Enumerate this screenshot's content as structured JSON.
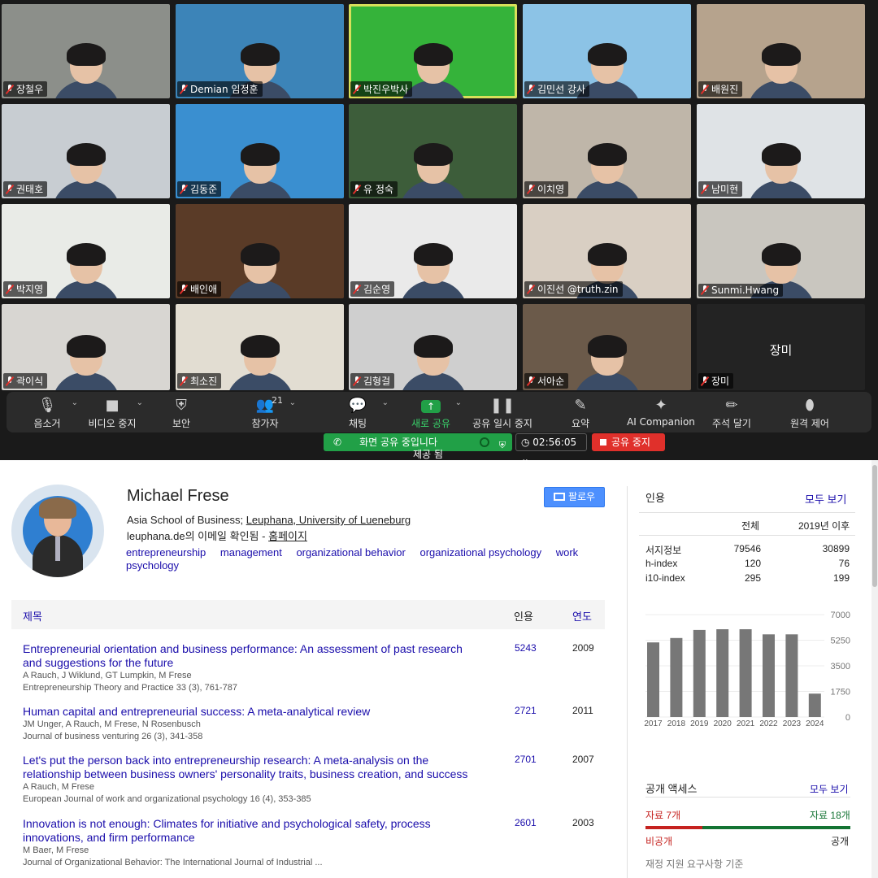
{
  "meeting": {
    "participants": [
      {
        "name": "장철우",
        "bg": "#8c8f8a"
      },
      {
        "name": "Demian 임정훈",
        "bg": "#3c84b8"
      },
      {
        "name": "박진우박사",
        "bg": "#35b33a"
      },
      {
        "name": "김민선 강사",
        "bg": "#8cc3e6"
      },
      {
        "name": "배원진",
        "bg": "#b6a38d"
      },
      {
        "name": "권태호",
        "bg": "#c8cdd2"
      },
      {
        "name": "김동준",
        "bg": "#3a8fd0"
      },
      {
        "name": "유 정숙",
        "bg": "#3d5d3a"
      },
      {
        "name": "이치영",
        "bg": "#bfb6a9"
      },
      {
        "name": "남미현",
        "bg": "#dfe3e6"
      },
      {
        "name": "박지영",
        "bg": "#e9ebe7"
      },
      {
        "name": "배인애",
        "bg": "#5a3b27"
      },
      {
        "name": "김순영",
        "bg": "#eaeaea"
      },
      {
        "name": "이진선 @truth.zin",
        "bg": "#d9cfc3"
      },
      {
        "name": "Sunmi.Hwang",
        "bg": "#c9c6bf"
      },
      {
        "name": "곽이식",
        "bg": "#d8d6d2"
      },
      {
        "name": "최소진",
        "bg": "#e2ddd2"
      },
      {
        "name": "김형걸",
        "bg": "#cfcfcf"
      },
      {
        "name": "서아순",
        "bg": "#6b5a4a"
      },
      {
        "name": "장미",
        "bg": "#232323",
        "name_only": true
      }
    ],
    "controls": [
      {
        "label": "음소거",
        "icon": "🎙"
      },
      {
        "label": "비디오 중지",
        "icon": "■"
      },
      {
        "label": "보안",
        "icon": "⛨"
      },
      {
        "label": "참가자",
        "icon": "👥",
        "count": "21"
      },
      {
        "label": "채팅",
        "icon": "💬"
      },
      {
        "label": "새로 공유",
        "icon": "↑"
      },
      {
        "label": "공유 일시 중지",
        "icon": "❚❚"
      },
      {
        "label": "요약",
        "icon": "✎"
      },
      {
        "label": "AI Companion",
        "icon": "✦"
      },
      {
        "label": "주석 달기",
        "icon": "✏"
      },
      {
        "label": "원격 제어",
        "icon": "⬮"
      }
    ],
    "banner_text": "화면 공유 중입니다",
    "timer": "02:56:05",
    "stop_label": "공유 중지",
    "overlap_text": "제공 됨"
  },
  "scholar": {
    "name": "Michael Frese",
    "affiliation_prefix": "Asia School of Business; ",
    "affiliation_link": "Leuphana, University of Lueneburg",
    "email_prefix": "leuphana.de의 이메일 확인됨 - ",
    "homepage_link": "홈페이지",
    "interests": [
      "entrepreneurship",
      "management",
      "organizational behavior",
      "organizational psychology",
      "work psychology"
    ],
    "follow_label": "팔로우",
    "table_header": {
      "title": "제목",
      "cites": "인용",
      "year": "연도"
    },
    "publications": [
      {
        "title": "Entrepreneurial orientation and business performance: An assessment of past research and suggestions for the future",
        "authors": "A Rauch, J Wiklund, GT Lumpkin, M Frese",
        "venue": "Entrepreneurship Theory and Practice 33 (3), 761-787",
        "cites": "5243",
        "year": "2009"
      },
      {
        "title": "Human capital and entrepreneurial success: A meta-analytical review",
        "authors": "JM Unger, A Rauch, M Frese, N Rosenbusch",
        "venue": "Journal of business venturing 26 (3), 341-358",
        "cites": "2721",
        "year": "2011"
      },
      {
        "title": "Let's put the person back into entrepreneurship research: A meta-analysis on the relationship between business owners' personality traits, business creation, and success",
        "authors": "A Rauch, M Frese",
        "venue": "European Journal of work and organizational psychology 16 (4), 353-385",
        "cites": "2701",
        "year": "2007"
      },
      {
        "title": "Innovation is not enough: Climates for initiative and psychological safety, process innovations, and firm performance",
        "authors": "M Baer, M Frese",
        "venue": "Journal of Organizational Behavior: The International Journal of Industrial ...",
        "cites": "2601",
        "year": "2003"
      }
    ],
    "citations": {
      "heading": "인용",
      "view_all": "모두 보기",
      "col_all": "전체",
      "col_since": "2019년 이후",
      "rows": [
        {
          "label": "서지정보",
          "all": "79546",
          "since": "30899"
        },
        {
          "label": "h-index",
          "all": "120",
          "since": "76"
        },
        {
          "label": "i10-index",
          "all": "295",
          "since": "199"
        }
      ]
    },
    "open_access": {
      "heading": "공개 액세스",
      "view_all": "모두 보기",
      "left_label": "자료 7개",
      "right_label": "자료 18개",
      "nonpublic": "비공개",
      "public": "공개",
      "note": "재정 지원 요구사항 기준"
    }
  },
  "chart_data": {
    "type": "bar",
    "categories": [
      "2017",
      "2018",
      "2019",
      "2020",
      "2021",
      "2022",
      "2023",
      "2024"
    ],
    "values": [
      5100,
      5400,
      5950,
      6000,
      6000,
      5650,
      5650,
      1600
    ],
    "yticks": [
      "7000",
      "5250",
      "3500",
      "1750",
      "0"
    ],
    "ylim": [
      0,
      7000
    ],
    "bar_color": "#777777"
  }
}
